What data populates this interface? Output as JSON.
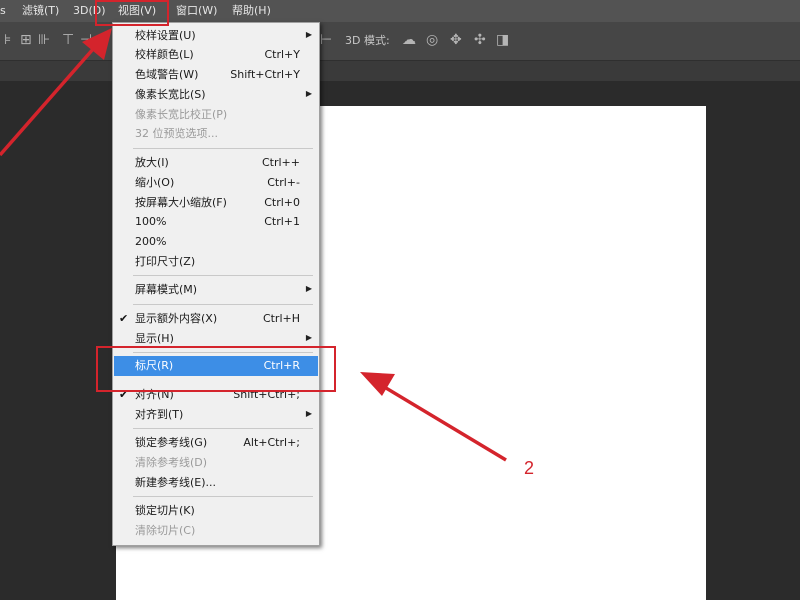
{
  "menubar": {
    "items": [
      {
        "label": "s"
      },
      {
        "label": "滤镜(T)"
      },
      {
        "label": "3D(D)"
      },
      {
        "label": "视图(V)"
      },
      {
        "label": "窗口(W)"
      },
      {
        "label": "帮助(H)"
      }
    ]
  },
  "toolbar": {
    "mode_label": "3D 模式:"
  },
  "view_menu": {
    "items": [
      {
        "label": "校样设置(U)",
        "shortcut": "",
        "submenu": true
      },
      {
        "label": "校样颜色(L)",
        "shortcut": "Ctrl+Y"
      },
      {
        "label": "色域警告(W)",
        "shortcut": "Shift+Ctrl+Y"
      },
      {
        "label": "像素长宽比(S)",
        "shortcut": "",
        "submenu": true
      },
      {
        "label": "像素长宽比校正(P)",
        "shortcut": "",
        "disabled": true
      },
      {
        "label": "32 位预览选项...",
        "shortcut": "",
        "disabled": true
      },
      {
        "label": "放大(I)",
        "shortcut": "Ctrl++"
      },
      {
        "label": "缩小(O)",
        "shortcut": "Ctrl+-"
      },
      {
        "label": "按屏幕大小缩放(F)",
        "shortcut": "Ctrl+0"
      },
      {
        "label": "100%",
        "shortcut": "Ctrl+1"
      },
      {
        "label": "200%",
        "shortcut": ""
      },
      {
        "label": "打印尺寸(Z)",
        "shortcut": ""
      },
      {
        "label": "屏幕模式(M)",
        "shortcut": "",
        "submenu": true
      },
      {
        "label": "显示额外内容(X)",
        "shortcut": "Ctrl+H",
        "checked": true
      },
      {
        "label": "显示(H)",
        "shortcut": "",
        "submenu": true
      },
      {
        "label": "标尺(R)",
        "shortcut": "Ctrl+R",
        "highlighted": true
      },
      {
        "label": "对齐(N)",
        "shortcut": "Shift+Ctrl+;",
        "checked": true
      },
      {
        "label": "对齐到(T)",
        "shortcut": "",
        "submenu": true
      },
      {
        "label": "锁定参考线(G)",
        "shortcut": "Alt+Ctrl+;"
      },
      {
        "label": "清除参考线(D)",
        "shortcut": "",
        "disabled": true
      },
      {
        "label": "新建参考线(E)...",
        "shortcut": ""
      },
      {
        "label": "锁定切片(K)",
        "shortcut": ""
      },
      {
        "label": "清除切片(C)",
        "shortcut": "",
        "disabled": true
      }
    ],
    "check_glyph": "✔",
    "arrow_glyph": "▶"
  },
  "annotation": {
    "step2": "2"
  },
  "colors": {
    "highlight": "#3d8ee6",
    "annotation_red": "#d4242c"
  }
}
